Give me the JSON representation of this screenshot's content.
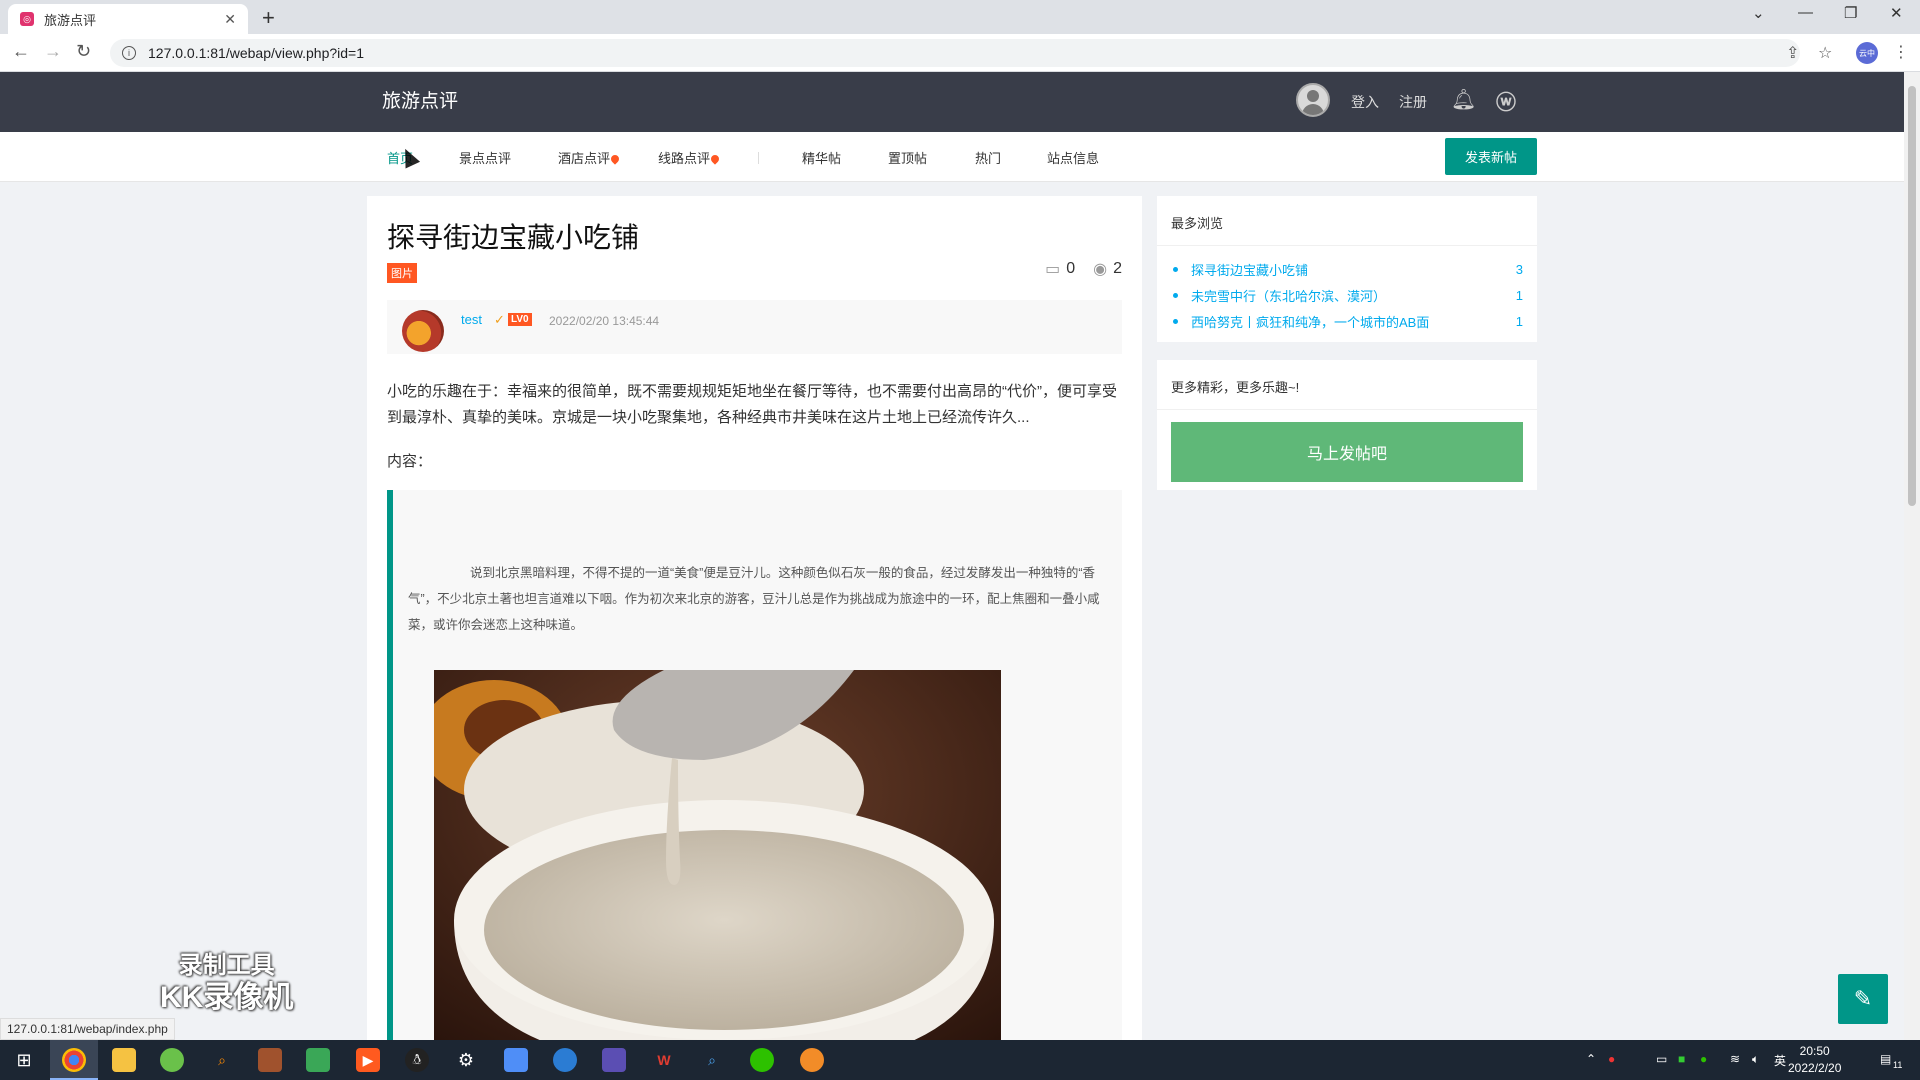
{
  "browser": {
    "tab_title": "旅游点评",
    "url": "127.0.0.1:81/webap/view.php?id=1",
    "profile_label": "云中",
    "status_url": "127.0.0.1:81/webap/index.php"
  },
  "header": {
    "logo": "旅游点评",
    "login": "登入",
    "register": "注册"
  },
  "nav": {
    "items": [
      "首页",
      "景点点评",
      "酒店点评",
      "线路点评",
      "精华帖",
      "置顶帖",
      "热门",
      "站点信息"
    ],
    "post_button": "发表新帖"
  },
  "post": {
    "title": "探寻街边宝藏小吃铺",
    "tag": "图片",
    "comments": "0",
    "views": "2",
    "author": "test",
    "level": "LV0",
    "date": "2022/02/20 13:45:44",
    "summary": "小吃的乐趣在于：幸福来的很简单，既不需要规规矩矩地坐在餐厅等待，也不需要付出高昂的“代价”，便可享受到最淳朴、真挚的美味。京城是一块小吃聚集地，各种经典市井美味在这片土地上已经流传许久...",
    "content_label": "内容：",
    "content_text": "说到北京黑暗料理，不得不提的一道“美食”便是豆汁儿。这种颜色似石灰一般的食品，经过发酵发出一种独特的“香气”，不少北京土著也坦言道难以下咽。作为初次来北京的游客，豆汁儿总是作为挑战成为旅途中的一环，配上焦圈和一叠小咸菜，或许你会迷恋上这种味道。"
  },
  "sidebar": {
    "most_viewed_title": "最多浏览",
    "most_viewed": [
      {
        "title": "探寻街边宝藏小吃铺",
        "count": "3"
      },
      {
        "title": "未完雪中行（东北哈尔滨、漠河）",
        "count": "1"
      },
      {
        "title": "西哈努克丨疯狂和纯净，一个城市的AB面",
        "count": "1"
      }
    ],
    "promo_title": "更多精彩，更多乐趣~!",
    "promo_button": "马上发帖吧"
  },
  "watermark": {
    "line1": "录制工具",
    "line2": "KK录像机"
  },
  "taskbar": {
    "time": "20:50",
    "date": "2022/2/20",
    "ime": "英",
    "notifications": "11"
  },
  "colors": {
    "accent": "#009688",
    "header": "#393d49",
    "link": "#01AAED",
    "hot": "#ff5722"
  }
}
